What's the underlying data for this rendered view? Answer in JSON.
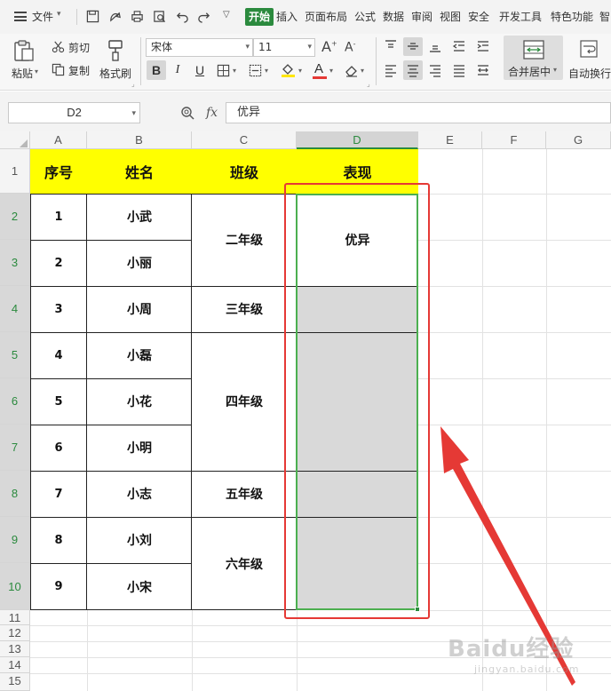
{
  "menubar": {
    "file_label": "文件",
    "tabs": [
      "开始",
      "插入",
      "页面布局",
      "公式",
      "数据",
      "审阅",
      "视图",
      "安全",
      "开发工具",
      "特色功能",
      "智"
    ],
    "active_tab": "开始",
    "accent_color": "#2b8a3e"
  },
  "ribbon": {
    "paste": "粘贴",
    "cut": "剪切",
    "copy": "复制",
    "format_painter": "格式刷",
    "font_name": "宋体",
    "font_size": "11",
    "bold": "B",
    "italic": "I",
    "underline": "U",
    "font_color_letter": "A",
    "merge_center": "合并居中",
    "wrap_text": "自动换行"
  },
  "formula_bar": {
    "name_box": "D2",
    "fx": "fx",
    "value": "优异"
  },
  "columns": [
    "A",
    "B",
    "C",
    "D",
    "E",
    "F",
    "G"
  ],
  "selected_column": "D",
  "rows": [
    "1",
    "2",
    "3",
    "4",
    "5",
    "6",
    "7",
    "8",
    "9",
    "10",
    "11",
    "12",
    "13",
    "14",
    "15"
  ],
  "selected_rows": [
    "2",
    "3",
    "4",
    "5",
    "6",
    "7",
    "8",
    "9",
    "10"
  ],
  "table": {
    "headers": [
      "序号",
      "姓名",
      "班级",
      "表现"
    ],
    "header_bg": "#ffff00",
    "ids": [
      "1",
      "2",
      "3",
      "4",
      "5",
      "6",
      "7",
      "8",
      "9"
    ],
    "names": [
      "小武",
      "小丽",
      "小周",
      "小磊",
      "小花",
      "小明",
      "小志",
      "小刘",
      "小宋"
    ],
    "classes": [
      "二年级",
      "三年级",
      "四年级",
      "五年级",
      "六年级"
    ],
    "performance": [
      "优异"
    ]
  },
  "watermark": {
    "brand": "Baidu经验",
    "url": "jingyan.baidu.com"
  },
  "colors": {
    "selection": "#4caf50",
    "highlight_box": "#e53935",
    "arrow": "#e53935",
    "selected_fill": "#d9d9d9"
  }
}
